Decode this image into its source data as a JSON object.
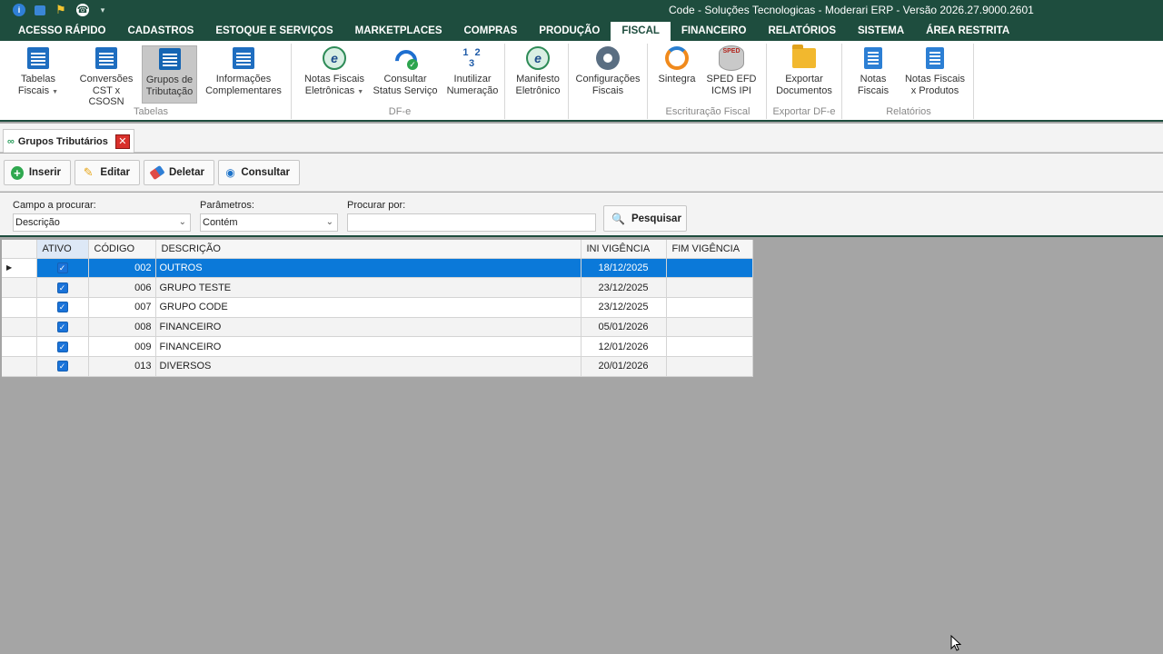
{
  "window": {
    "title": "Code - Soluções Tecnologicas - Moderari ERP - Versão 2026.27.9000.2601"
  },
  "menubar": {
    "items": [
      "ACESSO RÁPIDO",
      "CADASTROS",
      "ESTOQUE E SERVIÇOS",
      "MARKETPLACES",
      "COMPRAS",
      "PRODUÇÃO",
      "FISCAL",
      "FINANCEIRO",
      "RELATÓRIOS",
      "SISTEMA",
      "ÁREA RESTRITA"
    ],
    "active": "FISCAL"
  },
  "ribbon": {
    "buttons": {
      "tabelas_fiscais": [
        "Tabelas",
        "Fiscais"
      ],
      "conversoes": [
        "Conversões",
        "CST x CSOSN"
      ],
      "grupos": [
        "Grupos de",
        "Tributação"
      ],
      "info_compl": [
        "Informações",
        "Complementares"
      ],
      "notas_fiscais_ele": [
        "Notas Fiscais",
        "Eletrônicas"
      ],
      "consultar_status": [
        "Consultar",
        "Status Serviço"
      ],
      "inutilizar": [
        "Inutilizar",
        "Numeração"
      ],
      "manifesto": [
        "Manifesto",
        "Eletrônico"
      ],
      "configuracoes": [
        "Configurações",
        "Fiscais"
      ],
      "sintegra": [
        "Sintegra"
      ],
      "sped": [
        "SPED EFD",
        "ICMS IPI"
      ],
      "exportar": [
        "Exportar",
        "Documentos"
      ],
      "notas_fiscais": [
        "Notas",
        "Fiscais"
      ],
      "notas_produtos": [
        "Notas Fiscais",
        "x Produtos"
      ]
    },
    "icons": {
      "numeracao": "1 2 3",
      "nfe": "e",
      "sped": "SPED"
    },
    "groups": {
      "tabelas": "Tabelas",
      "dfe": "DF-e",
      "escrituracao": "Escrituração Fiscal",
      "exportar": "Exportar DF-e",
      "relatorios": "Relatórios"
    }
  },
  "doc_tab": {
    "label": "Grupos Tributários",
    "close": "✕"
  },
  "toolbar": {
    "inserir": "Inserir",
    "editar": "Editar",
    "deletar": "Deletar",
    "consultar": "Consultar"
  },
  "search": {
    "campo_label": "Campo a procurar:",
    "campo_value": "Descrição",
    "param_label": "Parâmetros:",
    "param_value": "Contém",
    "procurar_label": "Procurar por:",
    "procurar_value": "",
    "button": "Pesquisar"
  },
  "grid": {
    "columns": [
      "ATIVO",
      "CÓDIGO",
      "DESCRIÇÃO",
      "INI VIGÊNCIA",
      "FIM VIGÊNCIA"
    ],
    "rows": [
      {
        "ativo": true,
        "codigo": "002",
        "descricao": "OUTROS",
        "ini": "18/12/2025",
        "fim": ""
      },
      {
        "ativo": true,
        "codigo": "006",
        "descricao": "GRUPO TESTE",
        "ini": "23/12/2025",
        "fim": ""
      },
      {
        "ativo": true,
        "codigo": "007",
        "descricao": "GRUPO CODE",
        "ini": "23/12/2025",
        "fim": ""
      },
      {
        "ativo": true,
        "codigo": "008",
        "descricao": "FINANCEIRO",
        "ini": "05/01/2026",
        "fim": ""
      },
      {
        "ativo": true,
        "codigo": "009",
        "descricao": "FINANCEIRO",
        "ini": "12/01/2026",
        "fim": ""
      },
      {
        "ativo": true,
        "codigo": "013",
        "descricao": "DIVERSOS",
        "ini": "20/01/2026",
        "fim": ""
      }
    ],
    "selected_row": 0
  },
  "colors": {
    "brand": "#1e4d3e",
    "selection": "#0b79d9",
    "background": "#a5a5a5"
  }
}
